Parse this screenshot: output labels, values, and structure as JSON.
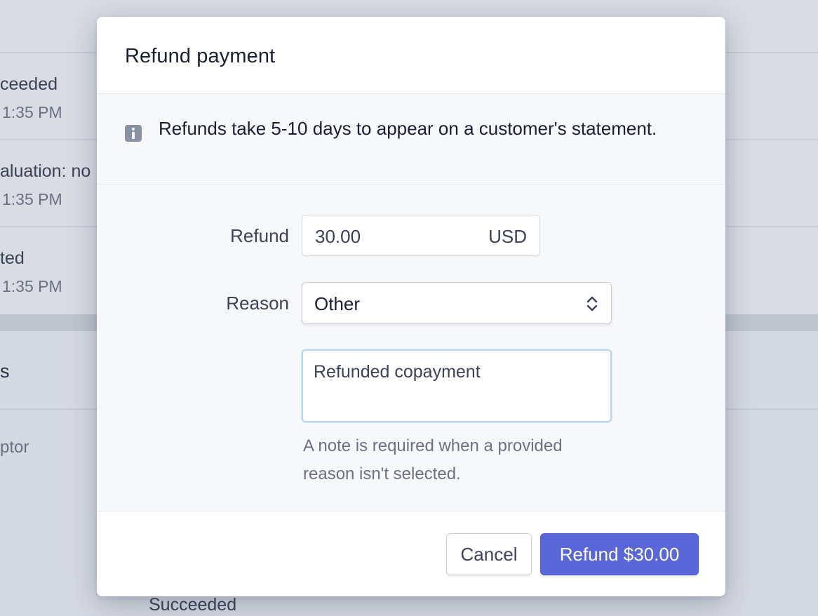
{
  "background": {
    "rows": [
      {
        "status": "ceeded",
        "time": "1:35 PM"
      },
      {
        "status": "aluation: no",
        "time": "1:35 PM"
      },
      {
        "status": "ted",
        "time": "1:35 PM"
      }
    ],
    "section_heading": "s",
    "section_item": "ptor",
    "bottom_status": "Succeeded"
  },
  "modal": {
    "title": "Refund payment",
    "notice": "Refunds take 5-10 days to appear on a customer's statement.",
    "notice_icon": "info-icon",
    "refund_label": "Refund",
    "refund_amount": "30.00",
    "refund_currency": "USD",
    "reason_label": "Reason",
    "reason_value": "Other",
    "note_value": "Refunded copayment",
    "note_hint": "A note is required when a provided reason isn't selected.",
    "cancel_label": "Cancel",
    "refund_button_label": "Refund $30.00"
  },
  "colors": {
    "primary": "#5a67d8",
    "focus_ring": "#b9d6ef",
    "overlay_bg": "#d5d9e1"
  }
}
